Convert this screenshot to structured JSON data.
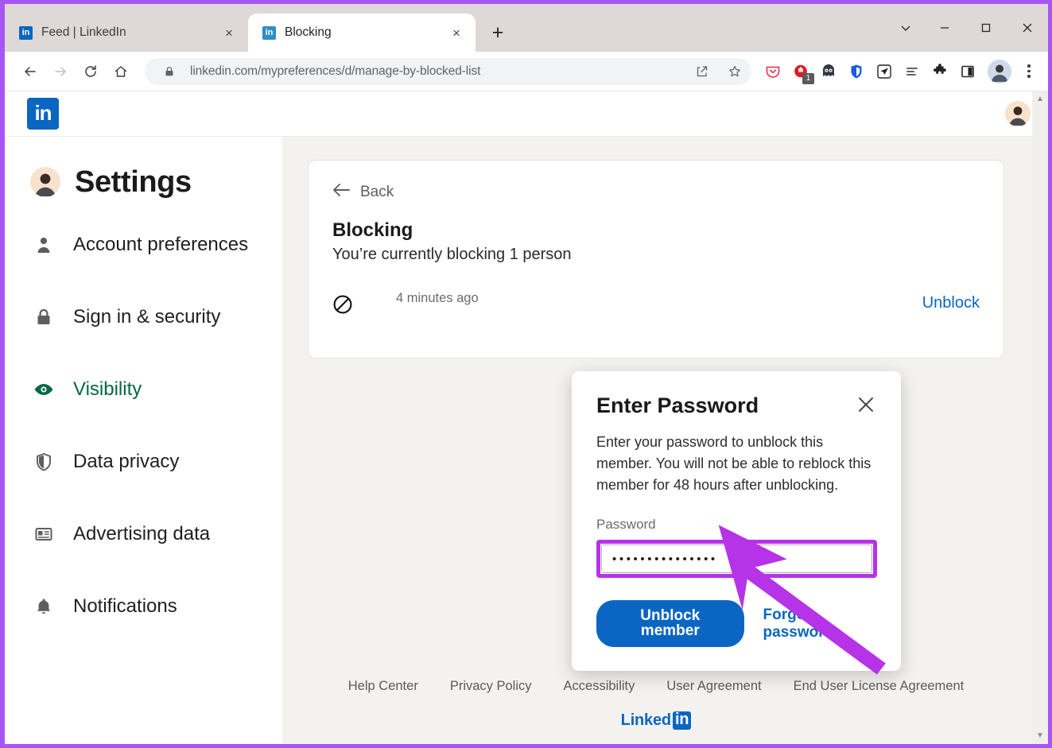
{
  "browser": {
    "tabs": [
      {
        "title": "Feed | LinkedIn",
        "favicon": "linkedin-favicon",
        "active": false,
        "close_label": "×"
      },
      {
        "title": "Blocking",
        "favicon": "linkedin-favicon",
        "active": true,
        "close_label": "×"
      }
    ],
    "new_tab_label": "+",
    "window_controls": {
      "chevron": "⌄",
      "minimize": "─",
      "maximize": "□",
      "close": "✕"
    },
    "nav": {
      "back": "←",
      "forward": "→",
      "reload": "⟳",
      "home": "⌂"
    },
    "url": "linkedin.com/mypreferences/d/manage-by-blocked-list",
    "url_secure_icon": "lock-icon",
    "omnibox_icons": [
      "share-icon",
      "bookmark-star-icon"
    ],
    "extensions": [
      {
        "name": "pocket-icon",
        "glyph": "▽",
        "badge": null
      },
      {
        "name": "adblock-icon",
        "glyph": "✋",
        "badge": "1"
      },
      {
        "name": "ghostery-icon",
        "glyph": "◑",
        "badge": null
      },
      {
        "name": "bitwarden-shield-icon",
        "glyph": "U",
        "badge": null
      },
      {
        "name": "telegram-send-icon",
        "glyph": "➤",
        "badge": null
      },
      {
        "name": "reading-list-icon",
        "glyph": "≡",
        "badge": null
      },
      {
        "name": "puzzle-extensions-icon",
        "glyph": "✦",
        "badge": null
      },
      {
        "name": "side-panel-icon",
        "glyph": "▣",
        "badge": null
      }
    ],
    "profile_avatar": "user-avatar",
    "menu": "three-dot-menu"
  },
  "linkedin_nav": {
    "logo_text": "in",
    "avatar": "user-avatar"
  },
  "sidebar": {
    "title": "Settings",
    "avatar": "user-avatar",
    "items": [
      {
        "label": "Account preferences",
        "icon": "person-icon",
        "active": false
      },
      {
        "label": "Sign in & security",
        "icon": "lock-icon",
        "active": false
      },
      {
        "label": "Visibility",
        "icon": "eye-icon",
        "active": true
      },
      {
        "label": "Data privacy",
        "icon": "shield-icon",
        "active": false
      },
      {
        "label": "Advertising data",
        "icon": "ad-card-icon",
        "active": false
      },
      {
        "label": "Notifications",
        "icon": "bell-icon",
        "active": false
      }
    ],
    "active_color": "#046943"
  },
  "main": {
    "back_label": "Back",
    "back_icon": "arrow-left-icon",
    "title": "Blocking",
    "subtitle": "You’re currently blocking 1 person",
    "blocked_list": [
      {
        "name": "",
        "name_redacted": true,
        "time": "4 minutes ago",
        "icon": "block-prohibition-icon",
        "action_label": "Unblock"
      }
    ]
  },
  "modal": {
    "title": "Enter Password",
    "close_icon": "close-icon",
    "body": "Enter your password to unblock this member. You will not be able to reblock this member for 48 hours after unblocking.",
    "password_label": "Password",
    "password_value": "•••••••••••••••",
    "password_placeholder": "Password",
    "primary_button": "Unblock member",
    "secondary_link": "Forgot password",
    "highlight_color": "#b633e8",
    "primary_color": "#0a66c2"
  },
  "footer": {
    "links": [
      "Help Center",
      "Privacy Policy",
      "Accessibility",
      "User Agreement",
      "End User License Agreement"
    ],
    "logo_word": "Linked",
    "logo_box": "in"
  },
  "annotation": {
    "arrow_color": "#b633e8",
    "points_to": "Unblock member"
  },
  "scrollbar": {
    "up": "▲",
    "down": "▼"
  }
}
